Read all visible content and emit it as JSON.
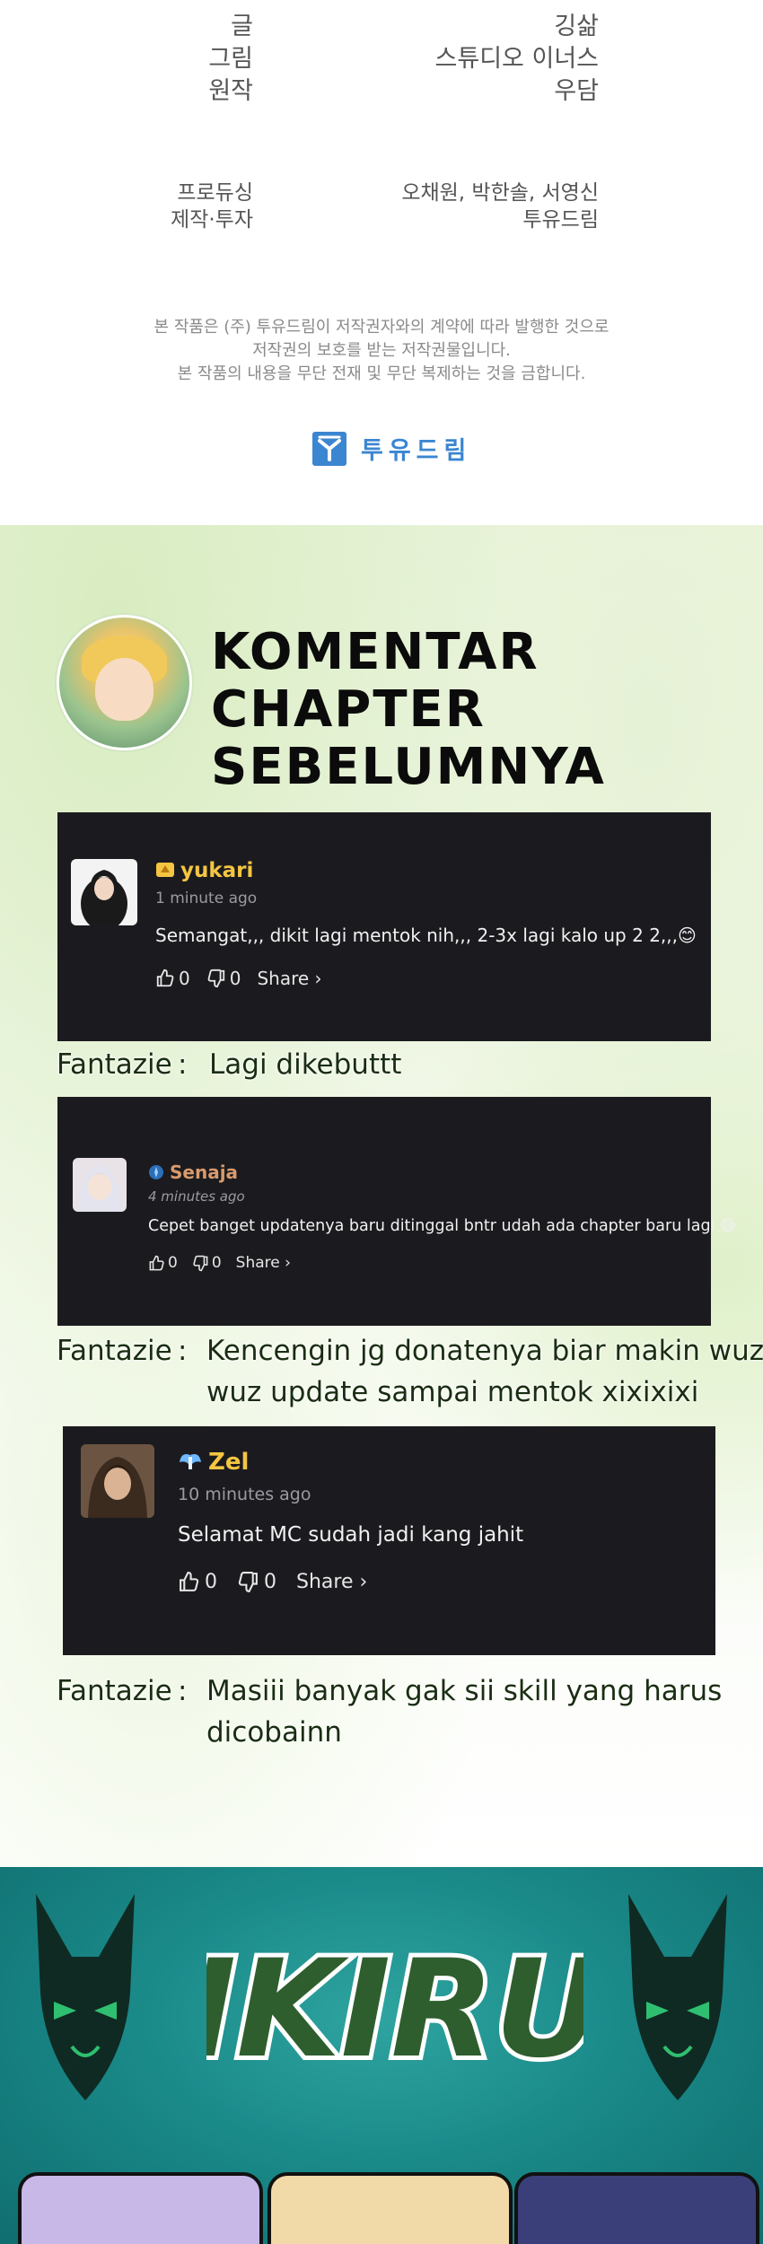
{
  "credits": {
    "rows": [
      {
        "role": "글",
        "name": "깅삶"
      },
      {
        "role": "그림",
        "name": "스튜디오 이너스"
      },
      {
        "role": "원작",
        "name": "우담"
      },
      {
        "role": "프로듀싱",
        "name": "오채원, 박한솔, 서영신"
      },
      {
        "role": "제작·투자",
        "name": "투유드림"
      }
    ],
    "rights": [
      "본 작품은 (주) 투유드림이 저작권자와의 계약에 따라 발행한 것으로",
      "저작권의 보호를 받는 저작권물입니다.",
      "본 작품의 내용을 무단 전재 및 무단 복제하는 것을 금합니다."
    ],
    "brand": "투유드림",
    "brand_color": "#3b86d1"
  },
  "comments_section": {
    "title_line1": "KOMENTAR CHAPTER",
    "title_line2": "SEBELUMNYA",
    "comments": [
      {
        "username": "yukari",
        "username_color": "#f5c542",
        "badge_icon": "sparkle-badge-icon",
        "time": "1 minute ago",
        "text": "Semangat,,, dikit lagi mentok nih,,, 2-3x lagi kalo up 2 2,,,😊",
        "likes": "0",
        "dislikes": "0",
        "share_label": "Share ›",
        "reply_author": "Fantazie",
        "reply_sep": ":",
        "reply_text": "Lagi dikebuttt"
      },
      {
        "username": "Senaja",
        "username_color": "#d99a6c",
        "badge_icon": "compass-badge-icon",
        "time": "4 minutes ago",
        "text": "Cepet banget updatenya baru ditinggal bntr udah ada chapter baru lagi 😅",
        "likes": "0",
        "dislikes": "0",
        "share_label": "Share ›",
        "reply_author": "Fantazie",
        "reply_sep": ":",
        "reply_text": "Kencengin jg donatenya biar makin wuz wuz update sampai mentok xixixixi"
      },
      {
        "username": "Zel",
        "username_color": "#f5c542",
        "badge_icon": "wings-badge-icon",
        "time": "10 minutes ago",
        "text": "Selamat MC sudah jadi kang jahit",
        "likes": "0",
        "dislikes": "0",
        "share_label": "Share ›",
        "reply_author": "Fantazie",
        "reply_sep": ":",
        "reply_text": "Masiii banyak gak sii skill yang harus dicobainn"
      }
    ]
  },
  "banner": {
    "logo_text": "IKIRU",
    "logo_color": "#2f5e2e",
    "background_color": "#1a8a89"
  }
}
